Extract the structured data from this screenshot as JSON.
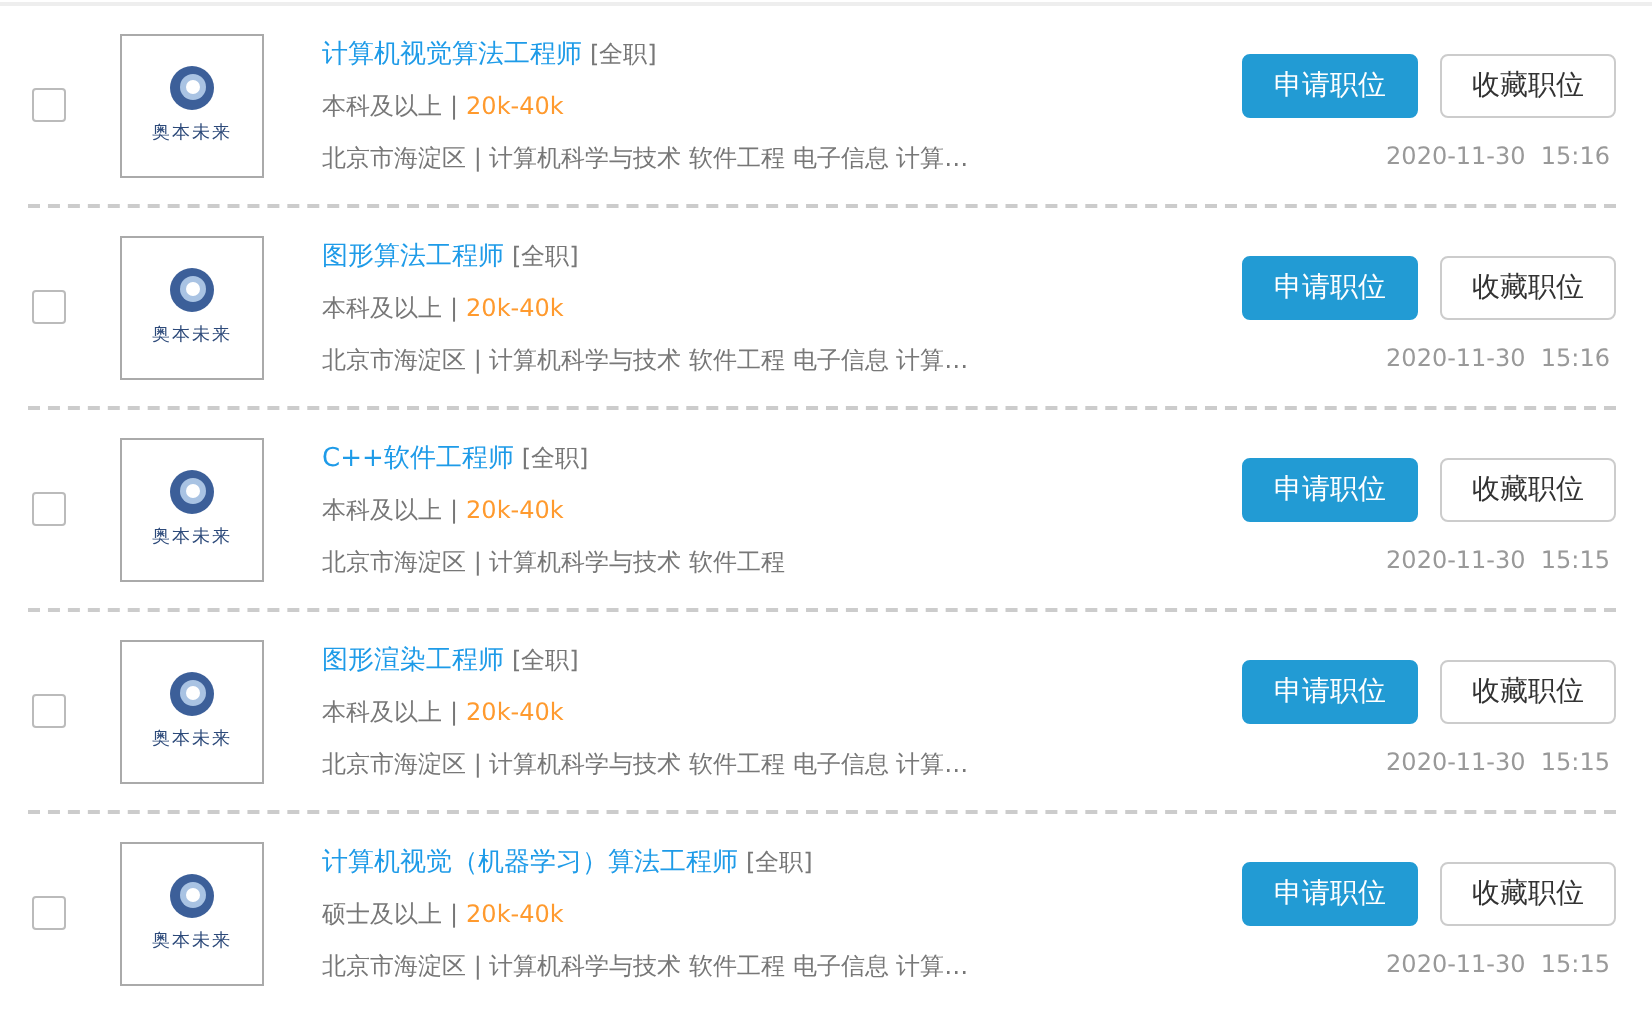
{
  "jobs": [
    {
      "checked": false,
      "logo_text": "奥本未来",
      "title": "计算机视觉算法工程师",
      "job_type": "[全职]",
      "education": "本科及以上",
      "separator": "|",
      "salary": "20k-40k",
      "details": "北京市海淀区 | 计算机科学与技术 软件工程 电子信息 计算…",
      "apply": "申请职位",
      "save": "收藏职位",
      "date": "2020-11-30  15:16"
    },
    {
      "checked": false,
      "logo_text": "奥本未来",
      "title": "图形算法工程师",
      "job_type": "[全职]",
      "education": "本科及以上",
      "separator": "|",
      "salary": "20k-40k",
      "details": "北京市海淀区 | 计算机科学与技术 软件工程 电子信息 计算…",
      "apply": "申请职位",
      "save": "收藏职位",
      "date": "2020-11-30  15:16"
    },
    {
      "checked": false,
      "logo_text": "奥本未来",
      "title": "C++软件工程师",
      "job_type": "[全职]",
      "education": "本科及以上",
      "separator": "|",
      "salary": "20k-40k",
      "details": "北京市海淀区 | 计算机科学与技术 软件工程",
      "apply": "申请职位",
      "save": "收藏职位",
      "date": "2020-11-30  15:15"
    },
    {
      "checked": false,
      "logo_text": "奥本未来",
      "title": "图形渲染工程师",
      "job_type": "[全职]",
      "education": "本科及以上",
      "separator": "|",
      "salary": "20k-40k",
      "details": "北京市海淀区 | 计算机科学与技术 软件工程 电子信息 计算…",
      "apply": "申请职位",
      "save": "收藏职位",
      "date": "2020-11-30  15:15"
    },
    {
      "checked": false,
      "logo_text": "奥本未来",
      "title": "计算机视觉（机器学习）算法工程师",
      "job_type": "[全职]",
      "education": "硕士及以上",
      "separator": "|",
      "salary": "20k-40k",
      "details": "北京市海淀区 | 计算机科学与技术 软件工程 电子信息 计算…",
      "apply": "申请职位",
      "save": "收藏职位",
      "date": "2020-11-30  15:15"
    }
  ]
}
